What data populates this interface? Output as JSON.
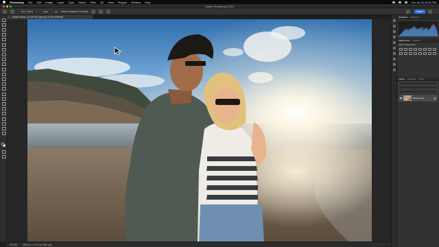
{
  "menubar": {
    "app_name": "Photoshop",
    "items": [
      "File",
      "Edit",
      "Image",
      "Layer",
      "Type",
      "Select",
      "Filter",
      "3D",
      "View",
      "Plugins",
      "Window",
      "Help"
    ],
    "clock": "Tue Jul 16 12:40 PM"
  },
  "window": {
    "title": "Adobe Photoshop 2024"
  },
  "options_bar": {
    "auto_select_label": "Auto-Select:",
    "layer_select": "Layer",
    "show_transform_label": "Show Transform Controls",
    "share_label": "Share"
  },
  "document_tab": {
    "label": "Adobe Stock_471337297.jpeg @ 33.3% (RGB/8)"
  },
  "status_bar": {
    "zoom": "33.33%",
    "doc_size": "5616 px x 3744 px (300 ppi)"
  },
  "panels": {
    "top_tabs": [
      "Histogram",
      "Navigator"
    ],
    "mid_tabs": [
      "Adjustments",
      "Libraries"
    ],
    "adjustments_title": "Add an adjustment",
    "layer_tabs": [
      "Layers",
      "Channels",
      "Paths"
    ],
    "layer_name": "Background",
    "histogram_colors": {
      "red": "#e03a3a",
      "green": "#3ad13a",
      "blue": "#3a6ee0"
    }
  },
  "colors": {
    "accent": "#2a6fdb",
    "traffic_red": "#ff5f57",
    "traffic_yellow": "#febc2e",
    "traffic_green": "#28c840"
  }
}
